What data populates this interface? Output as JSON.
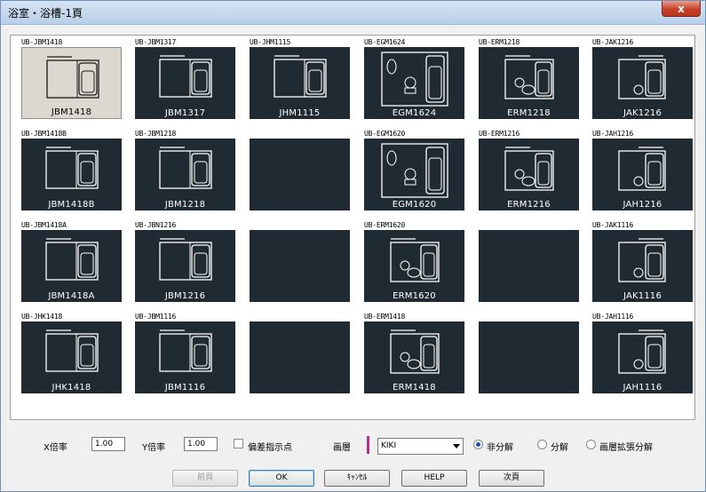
{
  "window": {
    "title": "浴室・浴槽-1頁",
    "close_glyph": "x"
  },
  "grid": [
    [
      {
        "label": "UB-JBM1418",
        "code": "JBM1418",
        "selected": true,
        "kind": "b2"
      },
      {
        "label": "UB-JBM1317",
        "code": "JBM1317",
        "kind": "b2"
      },
      {
        "label": "UB-JHM1115",
        "code": "JHM1115",
        "kind": "b2"
      },
      {
        "label": "UB-EGM1624",
        "code": "EGM1624",
        "kind": "eg"
      },
      {
        "label": "UB-ERM1218",
        "code": "ERM1218",
        "kind": "er"
      },
      {
        "label": "UB-JAK1216",
        "code": "JAK1216",
        "kind": "ja"
      }
    ],
    [
      {
        "label": "UB-JBM1418B",
        "code": "JBM1418B",
        "kind": "b2"
      },
      {
        "label": "UB-JBM1218",
        "code": "JBM1218",
        "kind": "b2"
      },
      {
        "label": "",
        "code": "",
        "kind": "empty"
      },
      {
        "label": "UB-EGM1620",
        "code": "EGM1620",
        "kind": "eg"
      },
      {
        "label": "UB-ERM1216",
        "code": "ERM1216",
        "kind": "er"
      },
      {
        "label": "UB-JAH1216",
        "code": "JAH1216",
        "kind": "ja"
      }
    ],
    [
      {
        "label": "UB-JBM1418A",
        "code": "JBM1418A",
        "kind": "b2"
      },
      {
        "label": "UB-JBN1216",
        "code": "JBM1216",
        "kind": "b2"
      },
      {
        "label": "",
        "code": "",
        "kind": "empty"
      },
      {
        "label": "UB-ERM1620",
        "code": "ERM1620",
        "kind": "er"
      },
      {
        "label": "",
        "code": "",
        "kind": "empty"
      },
      {
        "label": "UB-JAK1116",
        "code": "JAK1116",
        "kind": "ja"
      }
    ],
    [
      {
        "label": "UB-JHK1418",
        "code": "JHK1418",
        "kind": "b2"
      },
      {
        "label": "UB-JBM1116",
        "code": "JBM1116",
        "kind": "b2"
      },
      {
        "label": "",
        "code": "",
        "kind": "empty"
      },
      {
        "label": "UB-ERM1418",
        "code": "ERM1418",
        "kind": "er"
      },
      {
        "label": "",
        "code": "",
        "kind": "empty"
      },
      {
        "label": "UB-JAH1116",
        "code": "JAH1116",
        "kind": "ja"
      }
    ]
  ],
  "controls": {
    "x_scale_label": "X倍率",
    "x_scale_value": "1.00",
    "y_scale_label": "Y倍率",
    "y_scale_value": "1.00",
    "offset_point_label": "偏差指示点",
    "layer_label": "画層",
    "layer_value": "KIKI",
    "layer_color": "#b0308c",
    "radio_no_explode": "非分解",
    "radio_explode": "分解",
    "radio_layer_explode": "画層拡張分解"
  },
  "buttons": {
    "prev": "前頁",
    "ok": "OK",
    "cancel": "ｷｬﾝｾﾙ",
    "help": "HELP",
    "next": "次頁"
  }
}
